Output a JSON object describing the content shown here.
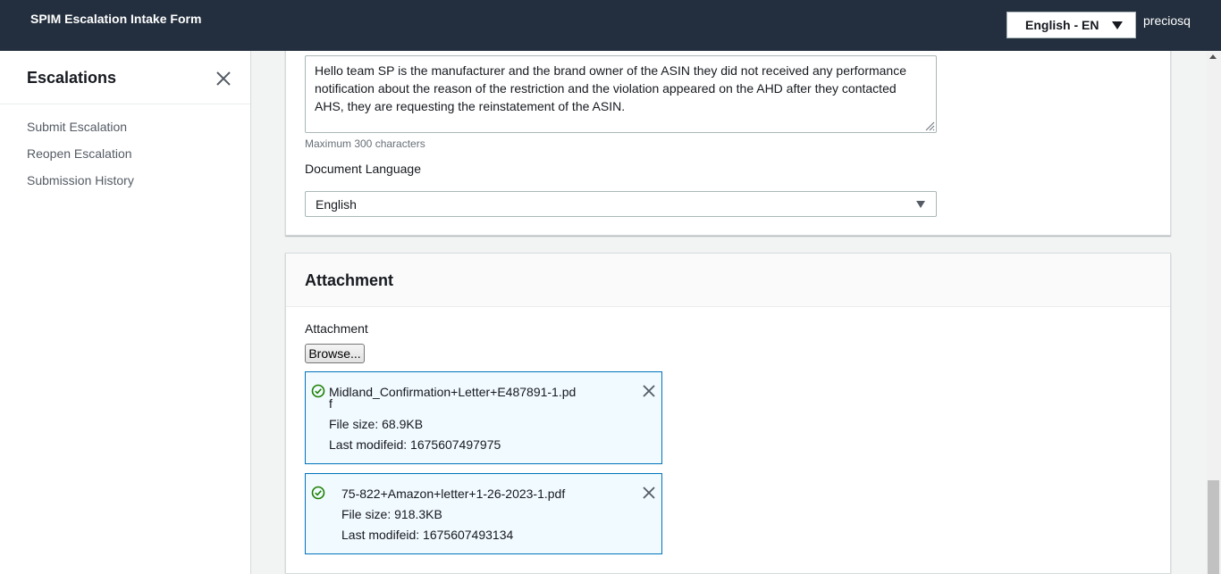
{
  "header": {
    "title": "SPIM Escalation Intake Form",
    "language": "English - EN",
    "username": "preciosq"
  },
  "sidebar": {
    "title": "Escalations",
    "items": [
      {
        "label": "Submit Escalation"
      },
      {
        "label": "Reopen Escalation"
      },
      {
        "label": "Submission History"
      }
    ]
  },
  "form": {
    "description_lines": [
      "Hello team SP is the manufacturer and the brand owner of the ASIN they did not received any performance",
      "notification about the reason of the restriction and the violation appeared on the AHD after they contacted",
      "AHS, they are requesting the reinstatement of the ASIN."
    ],
    "description_hint": "Maximum 300 characters",
    "doc_language_label": "Document Language",
    "doc_language_value": "English"
  },
  "attachment": {
    "section_title": "Attachment",
    "field_label": "Attachment",
    "browse_label": "Browse...",
    "files": [
      {
        "name_line1": "Midland_Confirmation+Letter+E487891-1.pd",
        "name_line2": "f",
        "size": "File size: 68.9KB",
        "modified": "Last modifeid: 1675607497975"
      },
      {
        "name": "75-822+Amazon+letter+1-26-2023-1.pdf",
        "size": "File size: 918.3KB",
        "modified": "Last modifeid: 1675607493134"
      }
    ]
  },
  "colors": {
    "header_bg": "#232f3e",
    "success_green": "#1d8102",
    "file_card_border": "#0073bb",
    "file_card_bg": "#f1faff"
  },
  "icons": {
    "close": "close-icon",
    "check": "check-circle-icon",
    "dropdown": "caret-down-icon",
    "resize": "resize-grip-icon"
  }
}
